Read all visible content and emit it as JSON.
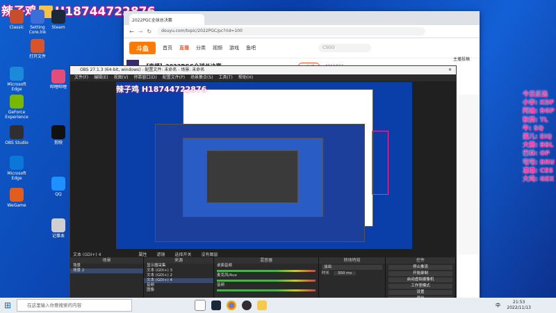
{
  "overlay": {
    "name": "辣子鸡",
    "phone": "H18744722876"
  },
  "desktop_icons": [
    {
      "label": "Classic",
      "color": "#c84d2a"
    },
    {
      "label": "Setting Core.lnk",
      "color": "#3c6dd8"
    },
    {
      "label": "Steam",
      "color": "#1b2838"
    },
    {
      "label": "打开文件",
      "color": "#d8552c"
    },
    {
      "label": "Microsoft Edge",
      "color": "#1b8ad8"
    },
    {
      "label": "GeForce Experience",
      "color": "#76b900"
    },
    {
      "label": "OBS Studio",
      "color": "#302e31"
    },
    {
      "label": "哔哩哔哩",
      "color": "#e44d7a"
    },
    {
      "label": "QQ",
      "color": "#1e90ff"
    },
    {
      "label": "剪映",
      "color": "#111111"
    },
    {
      "label": "Microsoft Edge",
      "color": "#0b77d9"
    },
    {
      "label": "WeGame",
      "color": "#e25c1c"
    },
    {
      "label": "记事本",
      "color": "#cfcfcf"
    }
  ],
  "sidelist": [
    "今日反选",
    "小李: KDF",
    "阿迪: BGP",
    "秋葵: TL",
    "牛: SQ",
    "蛋儿: EIQ",
    "大熊: BBL",
    "巴林: OP",
    "宅宅: BRU",
    "凛凛: CES",
    "大鸡: GEX"
  ],
  "browser": {
    "tab_title": "2022PGC全球总决赛",
    "url": "douyu.com/topic/2022PGC/pc?rid=100",
    "nav": [
      "首页",
      "直播",
      "分类",
      "视频",
      "游戏",
      "鱼吧"
    ],
    "search_placeholder": "CSGO",
    "room_title": "【直播】2022PGC全球总决赛",
    "follow": "+关注",
    "count": "4261062",
    "side_label": "主播投稿"
  },
  "obs": {
    "title": "OBS 27.1.3 (64-bit, windows) - 配置文件: 未命名 - 场景: 未命名",
    "menu": [
      "文件(F)",
      "编辑(E)",
      "视图(V)",
      "停靠窗口(D)",
      "配置文件(P)",
      "场景集合(S)",
      "工具(T)",
      "帮助(H)"
    ],
    "source_label": "文本 (GDI+) 4",
    "toolbar": [
      "属性",
      "滤镜",
      "选择开关",
      "没有图层"
    ],
    "docks": {
      "scenes": {
        "title": "场景",
        "items": [
          "场景",
          "场景 2"
        ]
      },
      "sources": {
        "title": "来源",
        "items": [
          "显示器采集",
          "文本 (GDI+) 3",
          "文本 (GDI+) 2",
          "文本 (GDI+) 4",
          "音频",
          "图像"
        ]
      },
      "mixer": {
        "title": "混音器",
        "items": [
          "桌面音频",
          "麦克风/Aux",
          "音频"
        ]
      },
      "transitions": {
        "title": "转场特效",
        "fade": "淡出",
        "duration_label": "时长",
        "duration": "300 ms"
      },
      "controls": {
        "title": "控件",
        "buttons": [
          "停止推流",
          "开始录制",
          "启动虚拟摄像机",
          "工作室模式",
          "设置",
          "退出"
        ]
      }
    }
  },
  "taskbar": {
    "search_placeholder": "在这里输入你要搜索的内容",
    "time": "21:53",
    "date": "2022/11/13",
    "lang": "中"
  }
}
